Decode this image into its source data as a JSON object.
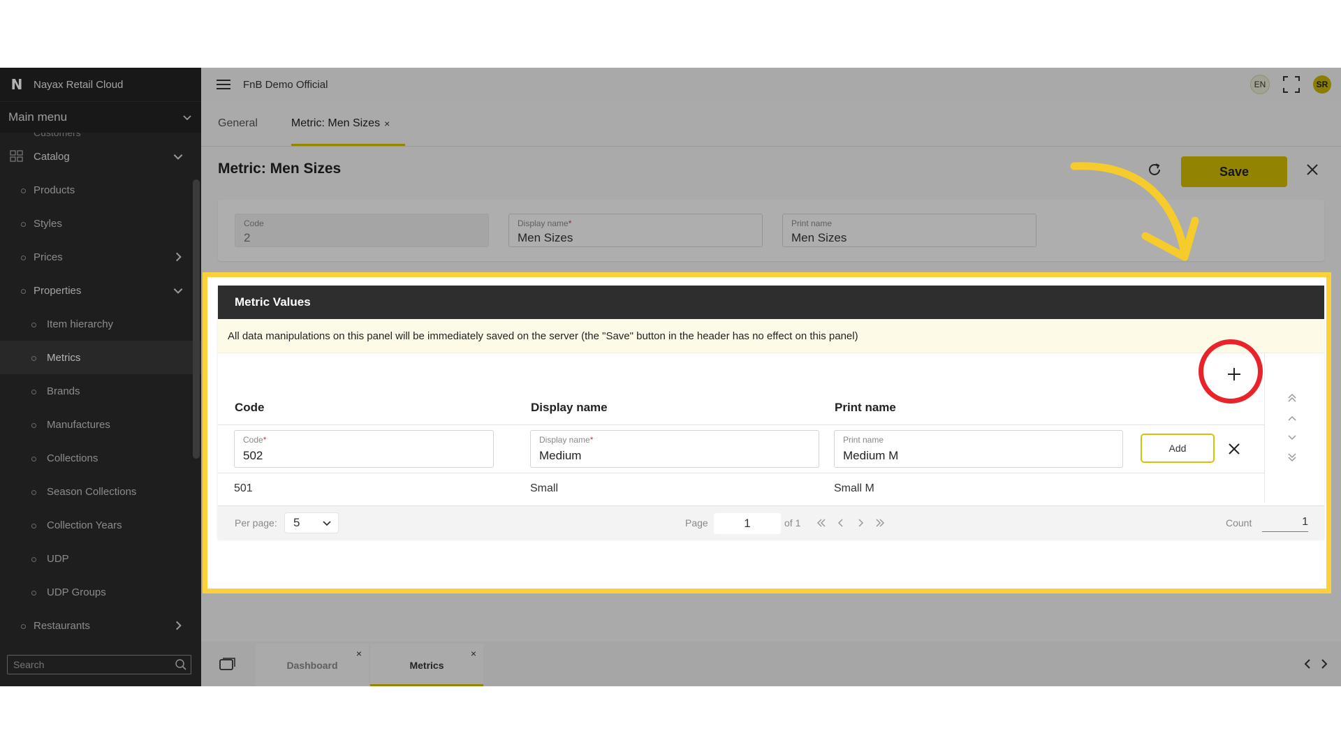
{
  "sidebar": {
    "brand": "Nayax Retail Cloud",
    "main_menu": "Main menu",
    "cut_item": "Customers",
    "catalog": "Catalog",
    "items": [
      {
        "label": "Products"
      },
      {
        "label": "Styles"
      },
      {
        "label": "Prices"
      },
      {
        "label": "Properties"
      }
    ],
    "property_items": [
      {
        "label": "Item hierarchy"
      },
      {
        "label": "Metrics"
      },
      {
        "label": "Brands"
      },
      {
        "label": "Manufactures"
      },
      {
        "label": "Collections"
      },
      {
        "label": "Season Collections"
      },
      {
        "label": "Collection Years"
      },
      {
        "label": "UDP"
      },
      {
        "label": "UDP Groups"
      }
    ],
    "restaurants": "Restaurants",
    "search_placeholder": "Search"
  },
  "topbar": {
    "org_name": "FnB Demo Official",
    "lang": "EN",
    "avatar": "SR"
  },
  "tabs": {
    "general": "General",
    "metric": "Metric: Men Sizes",
    "close": "×"
  },
  "form": {
    "title": "Metric: Men Sizes",
    "save_label": "Save",
    "code_label": "Code",
    "code_value": "2",
    "display_label": "Display name",
    "display_value": "Men Sizes",
    "print_label": "Print name",
    "print_value": "Men Sizes",
    "required_mark": "*"
  },
  "panel": {
    "title": "Metric Values",
    "notice": "All data manipulations on this panel will be immediately saved on the server (the \"Save\" button in the header has no effect on this panel)",
    "add_symbol": "+",
    "col_code": "Code",
    "col_display": "Display name",
    "col_print": "Print name",
    "edit_row": {
      "code_label": "Code",
      "code_value": "502",
      "display_label": "Display name",
      "display_value": "Medium",
      "print_label": "Print name",
      "print_value": "Medium M",
      "add_label": "Add"
    },
    "rows": [
      {
        "code": "501",
        "display": "Small",
        "print": "Small M"
      }
    ],
    "pager": {
      "per_page_label": "Per page:",
      "per_page_value": "5",
      "page_label": "Page",
      "page_value": "1",
      "of_label": "of 1",
      "count_label": "Count",
      "count_value": "1"
    }
  },
  "bottom_tabs": [
    {
      "label": "Dashboard"
    },
    {
      "label": "Metrics"
    }
  ],
  "colors": {
    "accent": "#d1bd00",
    "highlight": "#fbd03a",
    "ring": "#e8232a"
  }
}
